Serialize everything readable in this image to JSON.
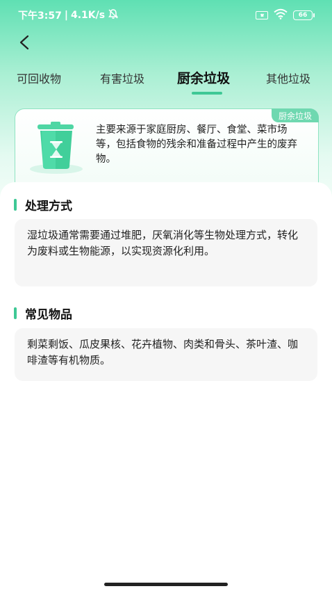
{
  "status_bar": {
    "time": "下午3:57",
    "net_speed": "4.1K/s",
    "battery": "66"
  },
  "tabs": [
    {
      "label": "可回收物"
    },
    {
      "label": "有害垃圾"
    },
    {
      "label": "厨余垃圾"
    },
    {
      "label": "其他垃圾"
    }
  ],
  "active_tab": 2,
  "info_card": {
    "tag": "厨余垃圾",
    "description": "主要来源于家庭厨房、餐厅、食堂、菜市场等，包括食物的残余和准备过程中产生的废弃物。",
    "icon": "kitchen-waste-bin-icon"
  },
  "sections": [
    {
      "title": "处理方式",
      "content": "湿垃圾通常需要通过堆肥，厌氧消化等生物处理方式，转化为废料或生物能源，以实现资源化利用。"
    },
    {
      "title": "常见物品",
      "content": "剩菜剩饭、瓜皮果核、花卉植物、肉类和骨头、茶叶渣、咖啡渣等有机物质。"
    }
  ],
  "colors": {
    "accent": "#3ec895",
    "gradient_top": "#5fe0b3",
    "tag_bg": "#6fd8b0"
  }
}
